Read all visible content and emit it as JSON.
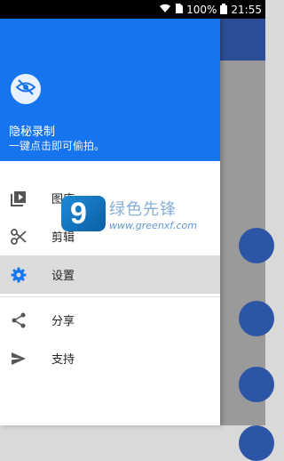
{
  "status_bar": {
    "battery": "100%",
    "time": "21:55"
  },
  "drawer": {
    "header": {
      "app_name": "隐秘录制",
      "tagline": "一键点击即可偷拍。"
    },
    "menu": [
      {
        "label": "图库",
        "icon": "gallery-icon"
      },
      {
        "label": "剪辑",
        "icon": "scissors-icon"
      },
      {
        "label": "设置",
        "icon": "gear-icon",
        "active": true
      },
      {
        "label": "分享",
        "icon": "share-icon"
      },
      {
        "label": "支持",
        "icon": "send-icon"
      }
    ]
  },
  "watermark": {
    "text": "绿色先锋",
    "url": "www.greenxf.com"
  },
  "colors": {
    "header": "#1774ef",
    "active_row": "#dcdcdc",
    "toolbar_behind": "#2b4e96"
  }
}
